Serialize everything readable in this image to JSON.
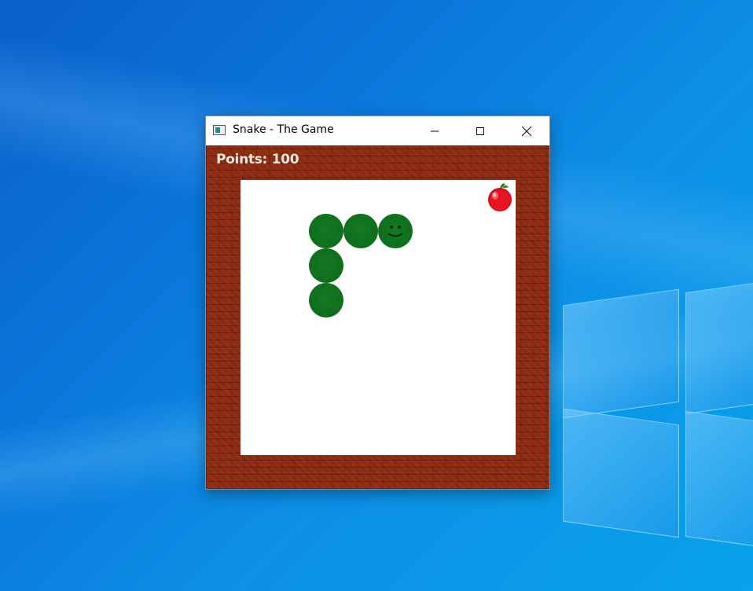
{
  "window": {
    "title": "Snake - The Game",
    "app_icon": "window-app-icon",
    "controls": {
      "minimize_icon": "minimize-icon",
      "maximize_icon": "maximize-icon",
      "close_icon": "close-icon"
    }
  },
  "game": {
    "points_label": "Points: 100",
    "points": 100,
    "wall_color": "#8a2b12",
    "field_color": "#ffffff",
    "snake_color": "#0f6e1e",
    "snake": {
      "head_icon": "smiley-face-icon",
      "segment_count": 5
    },
    "food_icon": "apple-icon",
    "food_color": "#e0101a"
  }
}
